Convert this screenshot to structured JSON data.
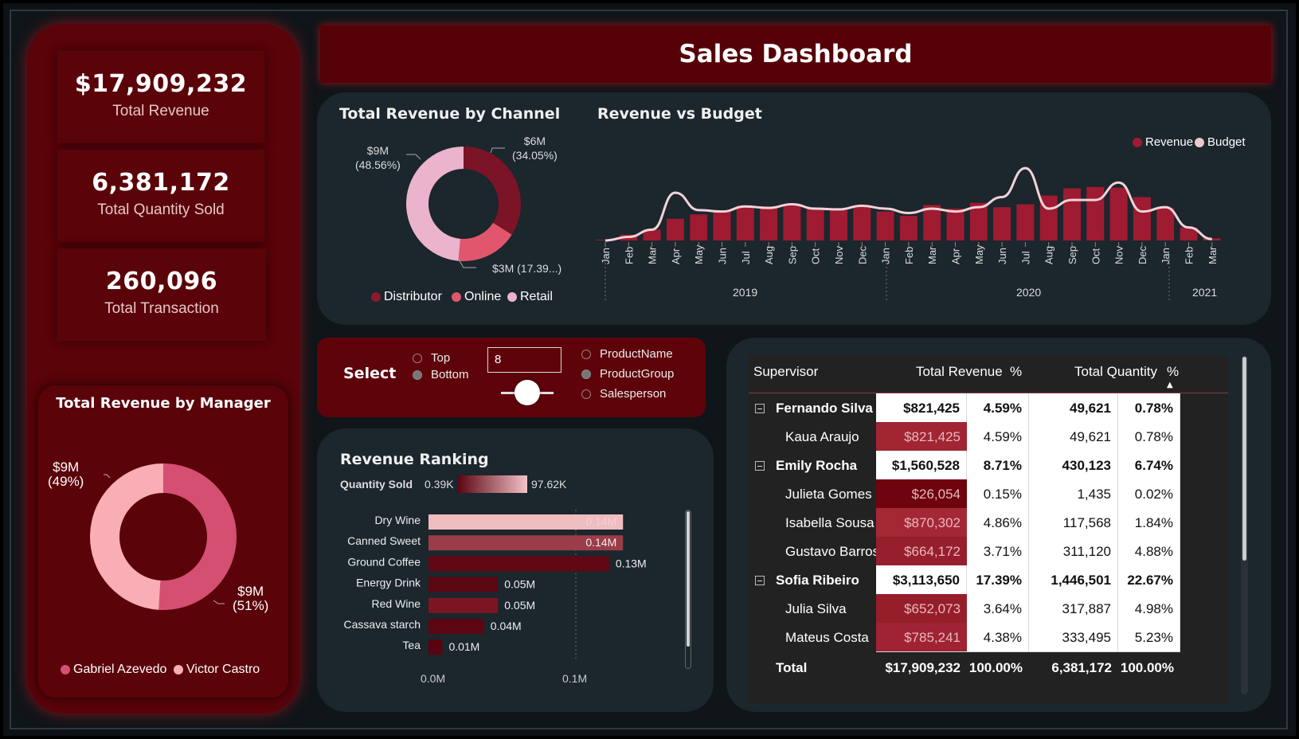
{
  "header": {
    "title": "Sales Dashboard"
  },
  "kpis": [
    {
      "value": "$17,909,232",
      "label": "Total Revenue"
    },
    {
      "value": "6,381,172",
      "label": "Total Quantity Sold"
    },
    {
      "value": "260,096",
      "label": "Total Transaction"
    }
  ],
  "manager_chart": {
    "title": "Total Revenue by Manager",
    "label_left_value": "$9M",
    "label_left_pct": "(49%)",
    "label_right_value": "$9M",
    "label_right_pct": "(51%)",
    "legend": [
      "Gabriel Azevedo",
      "Victor Castro"
    ]
  },
  "channel_chart": {
    "title": "Total Revenue by Channel",
    "label_retail_value": "$9M",
    "label_retail_pct": "(48.56%)",
    "label_dist_value": "$6M",
    "label_dist_pct": "(34.05%)",
    "label_online": "$3M (17.39...)",
    "legend": [
      "Distributor",
      "Online",
      "Retail"
    ]
  },
  "budget_chart": {
    "title": "Revenue vs Budget",
    "legend": [
      "Revenue",
      "Budget"
    ],
    "years": [
      "2019",
      "2020",
      "2021"
    ]
  },
  "select": {
    "label": "Select",
    "mode_options": [
      "Top",
      "Bottom"
    ],
    "number_value": "8",
    "dimension_options": [
      "ProductName",
      "ProductGroup",
      "Salesperson"
    ]
  },
  "ranking": {
    "title": "Revenue Ranking",
    "gradient_label": "Quantity Sold",
    "gradient_min": "0.39K",
    "gradient_max": "97.62K",
    "axis_ticks": [
      "0.0M",
      "0.1M"
    ]
  },
  "table": {
    "headers": [
      "Supervisor",
      "Total Revenue",
      "%",
      "Total Quantity",
      "%"
    ],
    "rows": [
      {
        "name": "Fernando Silva",
        "revenue": "$821,425",
        "rev_pct": "4.59%",
        "qty": "49,621",
        "qty_pct": "0.78%",
        "group": true
      },
      {
        "name": "Kaua Araujo",
        "revenue": "$821,425",
        "rev_pct": "4.59%",
        "qty": "49,621",
        "qty_pct": "0.78%",
        "group": false
      },
      {
        "name": "Emily Rocha",
        "revenue": "$1,560,528",
        "rev_pct": "8.71%",
        "qty": "430,123",
        "qty_pct": "6.74%",
        "group": true
      },
      {
        "name": "Julieta Gomes",
        "revenue": "$26,054",
        "rev_pct": "0.15%",
        "qty": "1,435",
        "qty_pct": "0.02%",
        "group": false
      },
      {
        "name": "Isabella Sousa",
        "revenue": "$870,302",
        "rev_pct": "4.86%",
        "qty": "117,568",
        "qty_pct": "1.84%",
        "group": false
      },
      {
        "name": "Gustavo Barros",
        "revenue": "$664,172",
        "rev_pct": "3.71%",
        "qty": "311,120",
        "qty_pct": "4.88%",
        "group": false
      },
      {
        "name": "Sofia Ribeiro",
        "revenue": "$3,113,650",
        "rev_pct": "17.39%",
        "qty": "1,446,501",
        "qty_pct": "22.67%",
        "group": true
      },
      {
        "name": "Julia Silva",
        "revenue": "$652,073",
        "rev_pct": "3.64%",
        "qty": "317,887",
        "qty_pct": "4.98%",
        "group": false
      },
      {
        "name": "Mateus Costa",
        "revenue": "$785,241",
        "rev_pct": "4.38%",
        "qty": "333,495",
        "qty_pct": "5.23%",
        "group": false
      }
    ],
    "total": {
      "name": "Total",
      "revenue": "$17,909,232",
      "rev_pct": "100.00%",
      "qty": "6,381,172",
      "qty_pct": "100.00%"
    }
  },
  "colors": {
    "dark_red": "#5a0309",
    "crimson": "#9e1b32",
    "pink": "#e87d93",
    "light_pink": "#efb6c9",
    "panel": "#1b262d"
  },
  "chart_data": [
    {
      "type": "pie",
      "categories": [
        "Gabriel Azevedo",
        "Victor Castro"
      ],
      "values": [
        49,
        51
      ],
      "title": "Total Revenue by Manager"
    },
    {
      "type": "pie",
      "categories": [
        "Distributor",
        "Online",
        "Retail"
      ],
      "values": [
        34.05,
        17.39,
        48.56
      ],
      "title": "Total Revenue by Channel"
    },
    {
      "type": "bar",
      "title": "Revenue vs Budget",
      "categories": [
        "Jan",
        "Feb",
        "Mar",
        "Apr",
        "May",
        "Jun",
        "Jul",
        "Aug",
        "Sep",
        "Oct",
        "Nov",
        "Dec",
        "Jan",
        "Feb",
        "Mar",
        "Apr",
        "May",
        "Jun",
        "Jul",
        "Aug",
        "Sep",
        "Oct",
        "Nov",
        "Dec",
        "Jan",
        "Feb",
        "Mar"
      ],
      "series": [
        {
          "name": "Revenue",
          "values": [
            0.01,
            0.08,
            0.15,
            0.3,
            0.36,
            0.4,
            0.48,
            0.47,
            0.48,
            0.44,
            0.42,
            0.48,
            0.4,
            0.34,
            0.49,
            0.44,
            0.52,
            0.46,
            0.5,
            0.62,
            0.72,
            0.74,
            0.73,
            0.6,
            0.45,
            0.18,
            0.03
          ]
        },
        {
          "name": "Budget",
          "values": [
            0.0,
            0.05,
            0.15,
            0.66,
            0.42,
            0.4,
            0.47,
            0.45,
            0.5,
            0.44,
            0.43,
            0.48,
            0.44,
            0.38,
            0.44,
            0.4,
            0.46,
            0.6,
            1.0,
            0.44,
            0.56,
            0.56,
            0.8,
            0.4,
            0.46,
            0.18,
            0.02
          ]
        }
      ],
      "ylim": [
        0,
        1.1
      ]
    },
    {
      "type": "bar",
      "title": "Revenue Ranking",
      "categories": [
        "Dry Wine",
        "Canned Sweet",
        "Ground Coffee",
        "Energy Drink",
        "Red Wine",
        "Cassava starch",
        "Tea"
      ],
      "values": [
        0.14,
        0.14,
        0.13,
        0.05,
        0.05,
        0.04,
        0.01
      ],
      "data_labels": [
        "0.14M",
        "0.14M",
        "0.13M",
        "0.05M",
        "0.05M",
        "0.04M",
        "0.01M"
      ],
      "colors": [
        "#efbcc0",
        "#9a3d48",
        "#620714",
        "#5c0612",
        "#7c1522",
        "#5c0612",
        "#5a0310"
      ],
      "ylim": [
        0,
        0.2
      ]
    }
  ]
}
